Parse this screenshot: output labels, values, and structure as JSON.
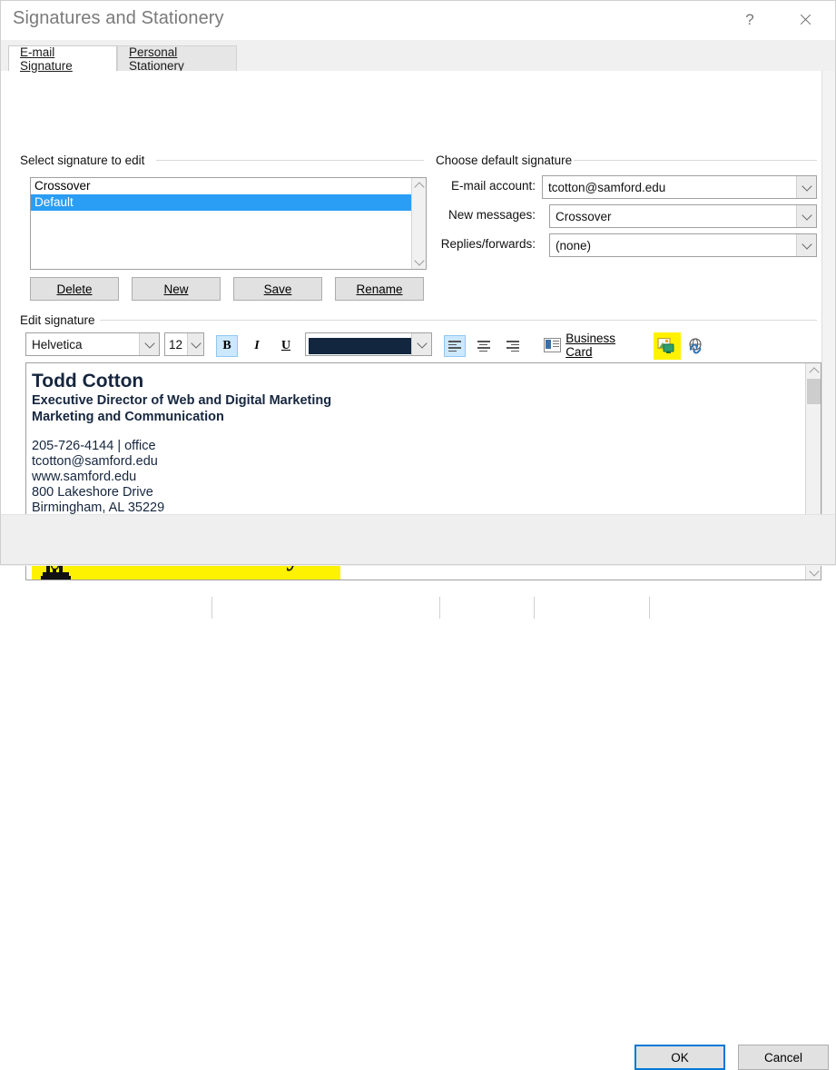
{
  "window": {
    "title": "Signatures and Stationery",
    "help_icon": "question-mark-icon",
    "close_icon": "close-icon"
  },
  "tabs": [
    {
      "label": "E-mail Signature",
      "accel": "E",
      "active": true
    },
    {
      "label": "Personal Stationery",
      "accel": "P",
      "active": false
    }
  ],
  "select_signature": {
    "group_label": "Select signature to edit",
    "items": [
      {
        "label": "Crossover",
        "selected": false
      },
      {
        "label": "Default",
        "selected": true
      }
    ],
    "selected_color": "#2a9df4",
    "buttons": [
      {
        "label": "Delete",
        "accel": "D"
      },
      {
        "label": "New",
        "accel": "N"
      },
      {
        "label": "Save",
        "accel": "S"
      },
      {
        "label": "Rename",
        "accel": "R"
      }
    ]
  },
  "choose_default": {
    "group_label": "Choose default signature",
    "fields": [
      {
        "label": "E-mail account:",
        "value": "tcotton@samford.edu"
      },
      {
        "label": "New messages:",
        "value": "Crossover"
      },
      {
        "label": "Replies/forwards:",
        "value": "(none)"
      }
    ]
  },
  "edit_signature": {
    "group_label": "Edit signature",
    "toolbar": {
      "font_family": "Helvetica",
      "font_size": "12",
      "bold": {
        "label": "B",
        "active": true
      },
      "italic": {
        "label": "I",
        "active": false
      },
      "underline": {
        "label": "U",
        "active": false
      },
      "font_color": "#12263f",
      "align": [
        {
          "name": "align-left",
          "active": true
        },
        {
          "name": "align-center",
          "active": false
        },
        {
          "name": "align-right",
          "active": false
        }
      ],
      "business_card_label": "Business Card",
      "insert_picture_icon": "insert-picture-icon",
      "insert_picture_highlight": "#fff200",
      "insert_hyperlink_icon": "insert-hyperlink-icon"
    },
    "preview": {
      "name": "Todd Cotton",
      "role_line1": "Executive Director of Web and Digital Marketing",
      "role_line2": "Marketing and Communication",
      "contact": [
        "205-726-4144 | office",
        "tcotton@samford.edu",
        "www.samford.edu",
        "800 Lakeshore Drive",
        "Birmingham, AL 35229"
      ],
      "text_color": "#16263f",
      "logo_text": "Samford University",
      "logo_highlight": "#fff200"
    }
  },
  "footer": {
    "ok_label": "OK",
    "cancel_label": "Cancel",
    "focus_color": "#0078d7"
  }
}
